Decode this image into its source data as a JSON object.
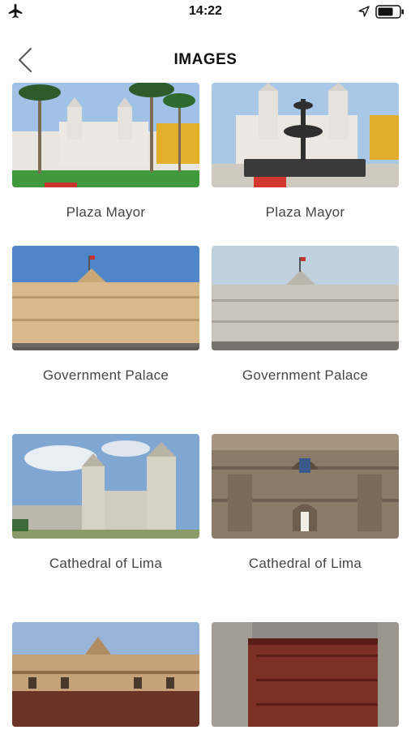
{
  "status": {
    "time": "14:22"
  },
  "header": {
    "title": "IMAGES"
  },
  "gallery": [
    {
      "label": "Plaza Mayor"
    },
    {
      "label": "Plaza Mayor"
    },
    {
      "label": "Government Palace"
    },
    {
      "label": "Government Palace"
    },
    {
      "label": "Cathedral of Lima"
    },
    {
      "label": "Cathedral of Lima"
    },
    {
      "label": ""
    },
    {
      "label": ""
    }
  ]
}
